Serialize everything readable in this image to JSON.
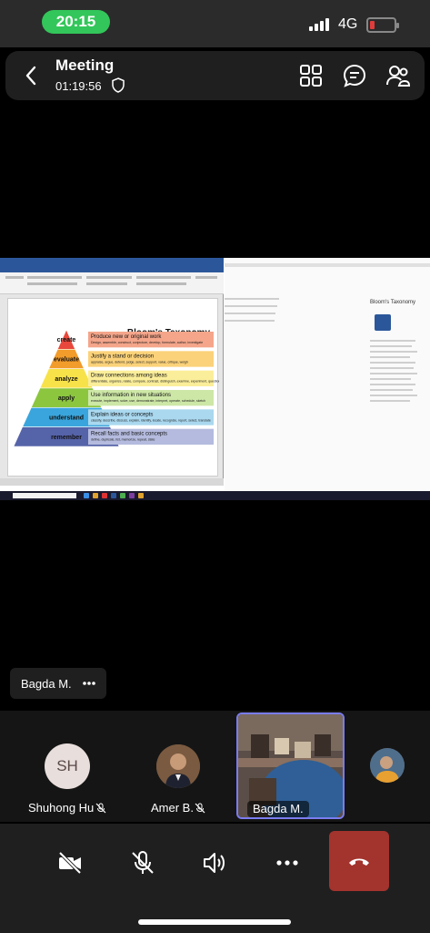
{
  "status_bar": {
    "time": "20:15",
    "network": "4G",
    "battery_color": "#e03c3c",
    "time_pill_color": "#33c65a"
  },
  "header": {
    "title": "Meeting",
    "timer": "01:19:56",
    "icons": [
      "back-chevron-icon",
      "shield-icon",
      "grid-layout-icon",
      "chat-icon",
      "participants-icon"
    ]
  },
  "shared_screen": {
    "document_title": "Bloom's Taxonomy",
    "explorer_title": "Bloom's Taxonomy",
    "taskbar_search": "Type here to search",
    "pyramid": [
      {
        "level": "create",
        "color": "#e8483b",
        "title": "Produce new or original work",
        "sub": "Design, assemble, construct, conjecture, develop, formulate, author, investigate",
        "box_color": "#f4a58a"
      },
      {
        "level": "evaluate",
        "color": "#f29c2b",
        "title": "Justify a stand or decision",
        "sub": "appraise, argue, defend, judge, select, support, value, critique, weigh",
        "box_color": "#fbd27a"
      },
      {
        "level": "analyze",
        "color": "#f7e24a",
        "title": "Draw connections among ideas",
        "sub": "differentiate, organize, relate, compare, contrast, distinguish, examine, experiment, question, test",
        "box_color": "#fbee9a"
      },
      {
        "level": "apply",
        "color": "#8cc63f",
        "title": "Use information in new situations",
        "sub": "execute, implement, solve, use, demonstrate, interpret, operate, schedule, sketch",
        "box_color": "#cde7a6"
      },
      {
        "level": "understand",
        "color": "#3aa5dc",
        "title": "Explain ideas or concepts",
        "sub": "classify, describe, discuss, explain, identify, locate, recognize, report, select, translate",
        "box_color": "#a9d8ef"
      },
      {
        "level": "remember",
        "color": "#5563a8",
        "title": "Recall facts and basic concepts",
        "sub": "define, duplicate, list, memorize, repeat, state",
        "box_color": "#b4bbde"
      }
    ]
  },
  "presenter": {
    "name": "Bagda M."
  },
  "participants": [
    {
      "initials": "SH",
      "name": "Shuhong Hu",
      "muted": true
    },
    {
      "name": "Amer B.",
      "muted": true
    },
    {
      "name": "Bagda M.",
      "video": true
    },
    {
      "name": ""
    }
  ],
  "controls": {
    "icons": [
      "camera-off-icon",
      "mic-off-icon",
      "speaker-icon",
      "more-icon",
      "hang-up-icon"
    ],
    "end_call_color": "#a3332d"
  }
}
